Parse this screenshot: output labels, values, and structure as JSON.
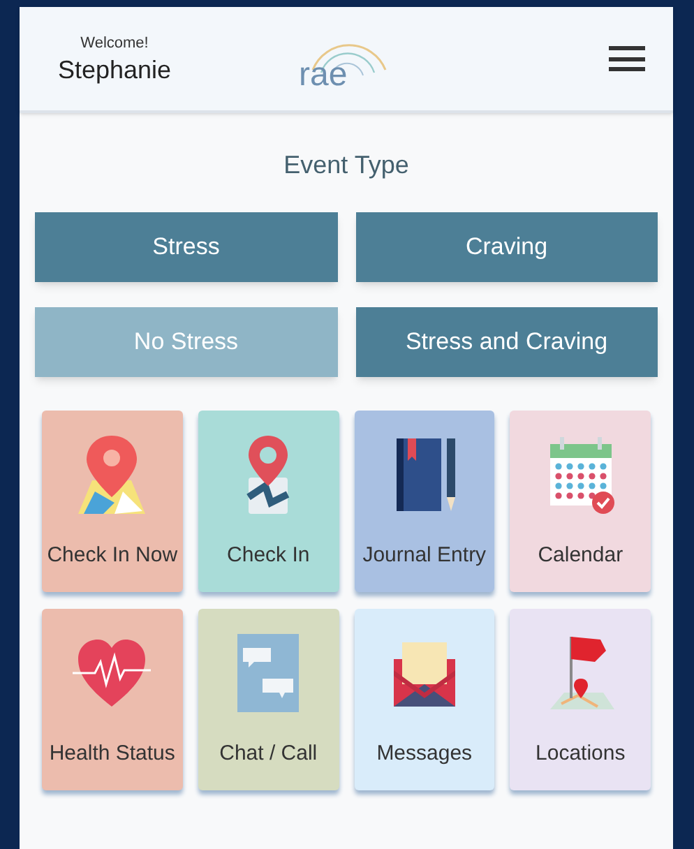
{
  "header": {
    "greeting": "Welcome!",
    "user_name": "Stephanie",
    "logo": "rae"
  },
  "section_title": "Event Type",
  "event_types": [
    {
      "label": "Stress",
      "selected": false
    },
    {
      "label": "Craving",
      "selected": false
    },
    {
      "label": "No Stress",
      "selected": true
    },
    {
      "label": "Stress and Craving",
      "selected": false
    }
  ],
  "tiles": [
    {
      "label": "Check In Now",
      "kind": "pin-map",
      "color": "#ecbcad"
    },
    {
      "label": "Check In",
      "kind": "pin-person",
      "color": "#a9dcd8"
    },
    {
      "label": "Journal Entry",
      "kind": "journal",
      "color": "#a9c0e2"
    },
    {
      "label": "Calendar",
      "kind": "calendar",
      "color": "#f1d9df"
    },
    {
      "label": "Health Status",
      "kind": "heart",
      "color": "#ecbcad"
    },
    {
      "label": "Chat / Call",
      "kind": "chat",
      "color": "#d6dcc0"
    },
    {
      "label": "Messages",
      "kind": "envelope",
      "color": "#d9ecfa"
    },
    {
      "label": "Locations",
      "kind": "flag",
      "color": "#e9e3f3"
    }
  ]
}
